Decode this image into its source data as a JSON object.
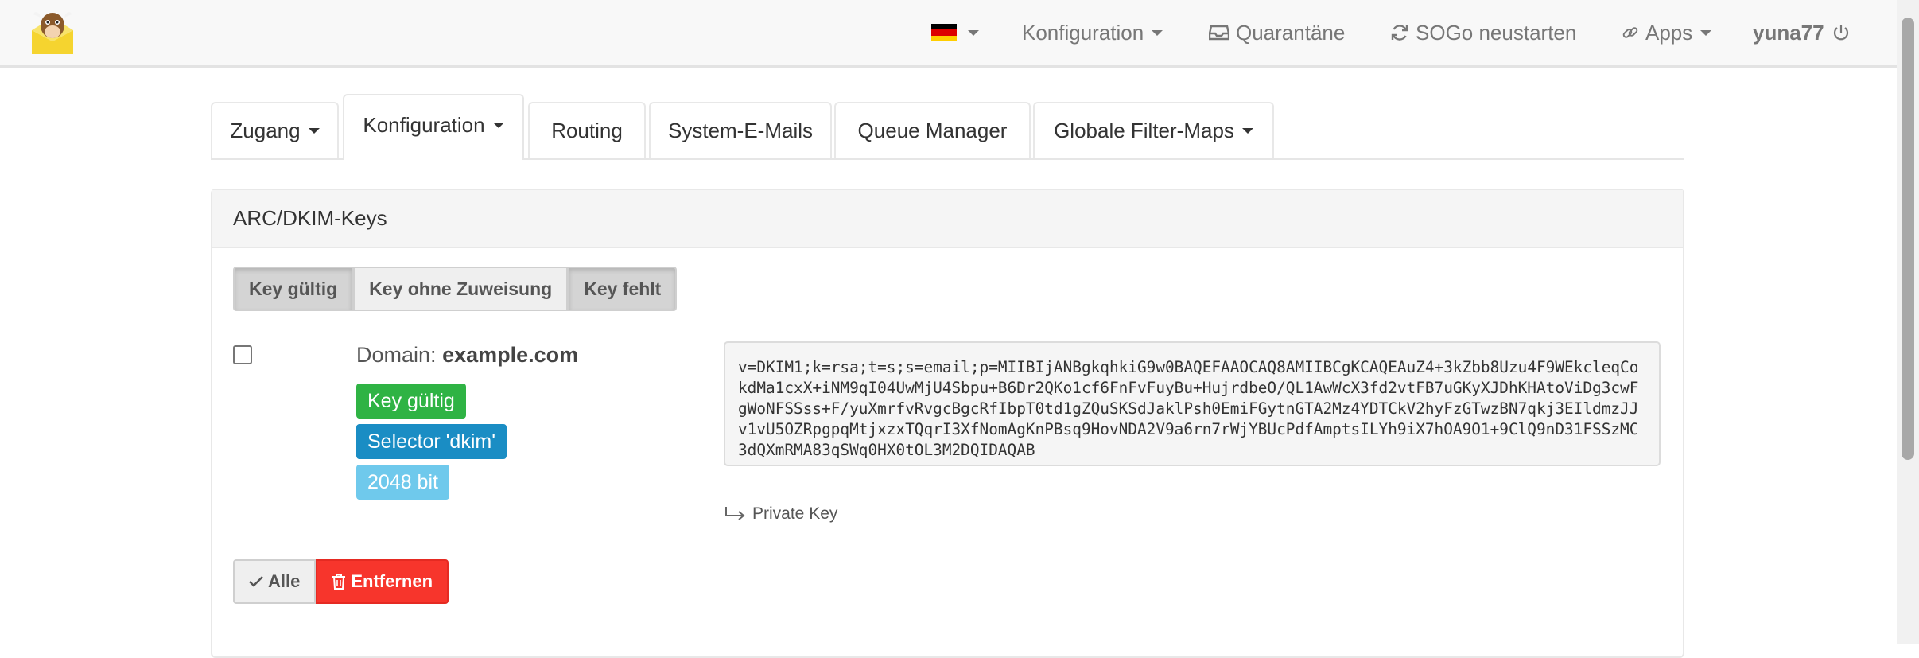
{
  "navbar": {
    "language_flag": "flag-de",
    "menu_config": "Konfiguration",
    "menu_quarantine": "Quarantäne",
    "menu_sogo_restart": "SOGo neustarten",
    "menu_apps": "Apps",
    "user": "yuna77"
  },
  "tabs": [
    {
      "label": "Zugang",
      "has_dropdown": true
    },
    {
      "label": "Konfiguration",
      "has_dropdown": true,
      "active": true
    },
    {
      "label": "Routing"
    },
    {
      "label": "System-E-Mails"
    },
    {
      "label": "Queue Manager"
    },
    {
      "label": "Globale Filter-Maps",
      "has_dropdown": true
    }
  ],
  "panel": {
    "title": "ARC/DKIM-Keys",
    "filters": [
      {
        "label": "Key gültig",
        "active": true
      },
      {
        "label": "Key ohne Zuweisung",
        "active": false
      },
      {
        "label": "Key fehlt",
        "active": true
      }
    ],
    "entry": {
      "domain_prefix": "Domain:",
      "domain": "example.com",
      "label_valid": "Key gültig",
      "label_selector": "Selector 'dkim'",
      "label_bits": "2048 bit",
      "dkim_record": "v=DKIM1;k=rsa;t=s;s=email;p=MIIBIjANBgkqhkiG9w0BAQEFAAOCAQ8AMIIBCgKCAQEAuZ4+3kZbb8Uzu4F9WEkcleqCokdMa1cxX+iNM9qI04UwMjU4Sbpu+B6Dr2QKo1cf6FnFvFuyBu+HujrdbeO/QL1AwWcX3fd2vtFB7uGKyXJDhKHAtoViDg3cwFgWoNFSSss+F/yuXmrfvRvgcBgcRfIbpT0td1gZQuSKSdJaklPsh0EmiFGytnGTA2Mz4YDTCkV2hyFzGTwzBN7qkj3EIldmzJJv1vU5OZRpgpqMtjxzxTQqrI3XfNomAgKnPBsq9HovNDA2V9a6rn7rWjYBUcPdfAmptsILYh9iX7hOA9O1+9ClQ9nD31FSSzMC3dQXmRMA83qSWq0HX0tOL3M2DQIDAQAB",
      "private_key_label": "Private Key"
    },
    "btn_all": "Alle",
    "btn_remove": "Entfernen"
  },
  "colors": {
    "label_valid": "#2fb344",
    "label_selector": "#1a8dc4",
    "label_bits": "#6fc9ec",
    "danger": "#f7352c"
  }
}
